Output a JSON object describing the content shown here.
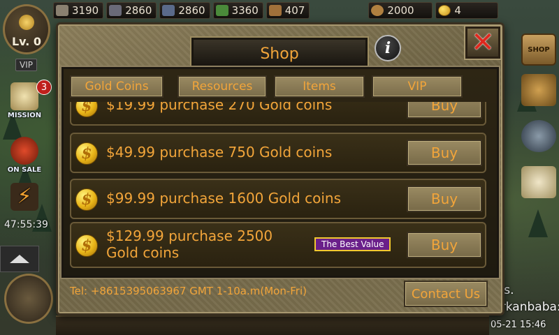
{
  "resources": [
    {
      "name": "stone",
      "value": "3190",
      "color": "#8a8070"
    },
    {
      "name": "iron",
      "value": "2860",
      "color": "#6a6a78"
    },
    {
      "name": "steel",
      "value": "2860",
      "color": "#5a6a8a"
    },
    {
      "name": "food",
      "value": "3360",
      "color": "#4a8a3a"
    },
    {
      "name": "troops",
      "value": "407",
      "color": "#a0703a"
    },
    {
      "name": "money-bag",
      "value": "2000",
      "color": "#b08040"
    },
    {
      "name": "gold",
      "value": "4",
      "color": "#e8b418"
    }
  ],
  "hud": {
    "level": "Lv. 0",
    "vip": "VIP",
    "mission_label": "MISSION",
    "mission_badge": "3",
    "on_sale_label": "ON SALE",
    "timer": "47:55:39",
    "shop_sign": "SHOP"
  },
  "shop": {
    "title": "Shop",
    "info_icon": "i",
    "tabs": [
      "Gold Coins",
      "Resources",
      "Items",
      "VIP"
    ],
    "offers": [
      {
        "text": "$19.99 purchase 270 Gold coins",
        "buy": "Buy",
        "partial": true
      },
      {
        "text": "$49.99 purchase 750 Gold coins",
        "buy": "Buy"
      },
      {
        "text": "$99.99 purchase 1600 Gold coins",
        "buy": "Buy"
      },
      {
        "text": "$129.99 purchase 2500 Gold coins",
        "buy": "Buy",
        "badge": "The Best Value"
      }
    ],
    "footer_tel": "Tel:  +8615395063967  GMT 1-10a.m(Mon-Fri)",
    "contact": "Contact Us"
  },
  "chat": {
    "line1": "des.",
    "line2": "furkanbaba:...",
    "time": "05-21 15:46"
  },
  "colors": {
    "accent_text": "#f2a53a",
    "panel": "#7d7150",
    "best_value_bg": "#6a1f8a"
  }
}
